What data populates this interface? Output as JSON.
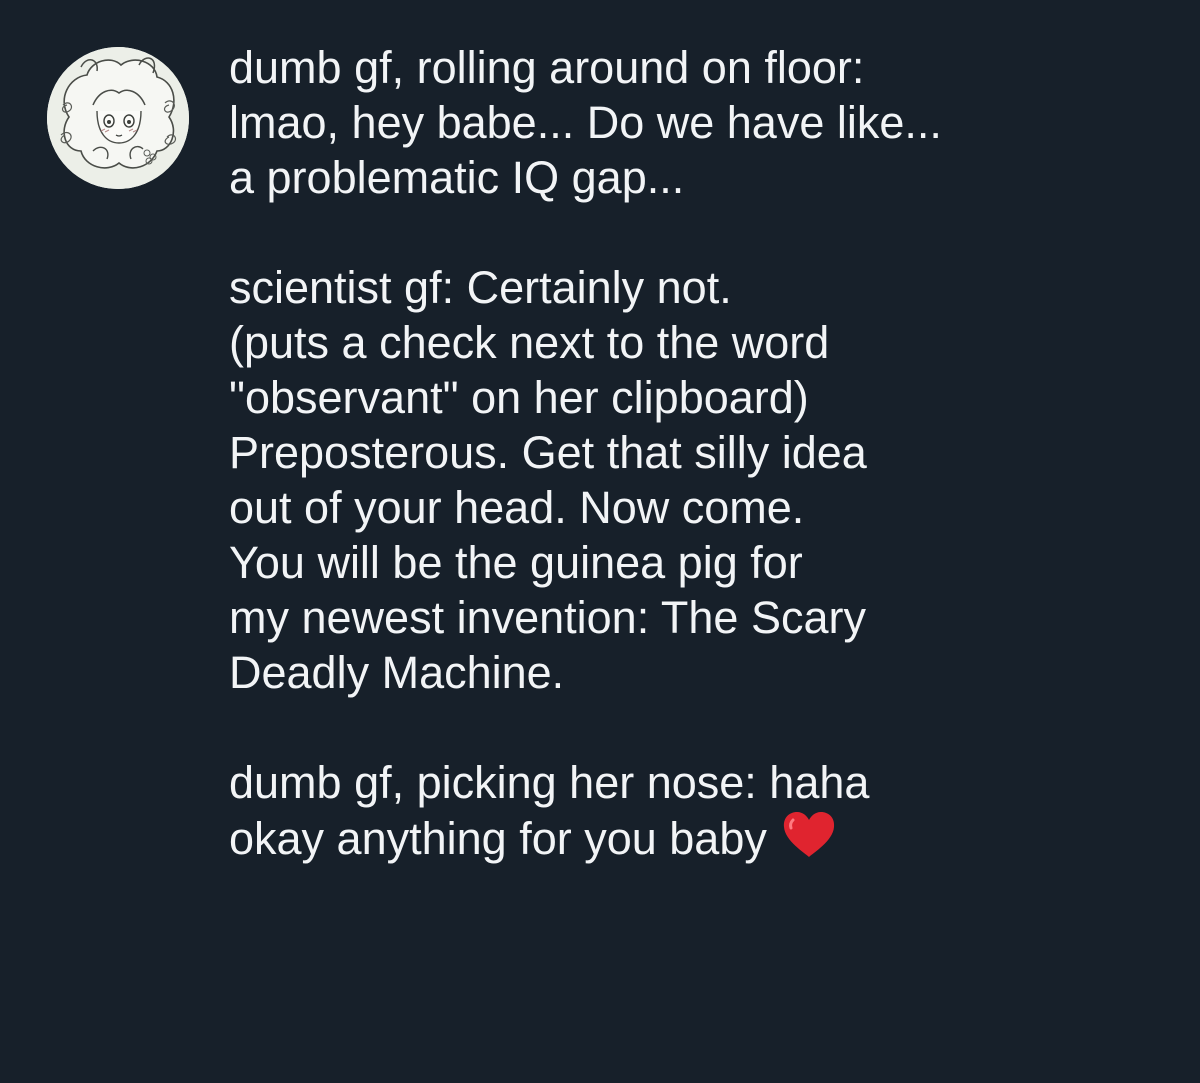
{
  "post": {
    "avatar": {
      "icon": "anime-girl-sketch-avatar",
      "background": "#ecefe8"
    },
    "stanzas": [
      {
        "lines": [
          "dumb gf, rolling around on floor:",
          "lmao, hey babe... Do we have like...",
          "a problematic IQ gap..."
        ]
      },
      {
        "lines": [
          "scientist gf: Certainly not.",
          "(puts a check next to the word",
          "\"observant\" on her clipboard)",
          "Preposterous. Get that silly idea",
          "out of your head. Now come.",
          "You will be the guinea pig for",
          "my newest invention: The Scary",
          "Deadly Machine."
        ]
      },
      {
        "lines": [
          "dumb gf, picking her nose: haha",
          "okay anything for you baby"
        ],
        "trailing_emoji": "red-heart-icon"
      }
    ]
  },
  "colors": {
    "background": "#17202a",
    "text": "#f2f4f6",
    "heart": "#e0242f"
  }
}
